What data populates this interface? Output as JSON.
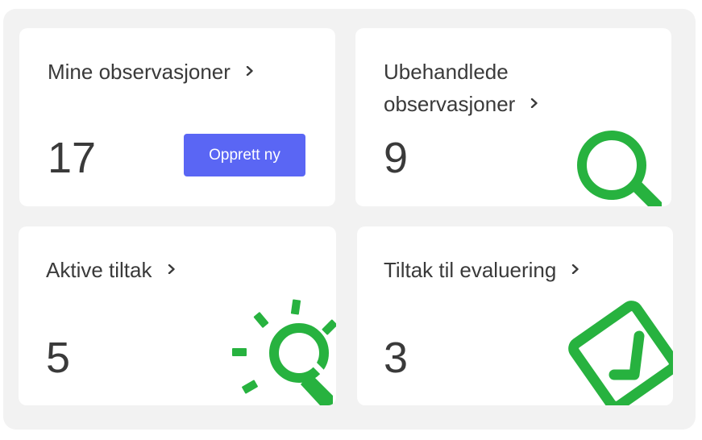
{
  "cards": [
    {
      "title": "Mine observasjoner",
      "count": "17",
      "button_label": "Opprett ny",
      "illustration_icon": "none"
    },
    {
      "title_line1": "Ubehandlede",
      "title_line2": "observasjoner",
      "count": "9",
      "illustration_icon": "magnifier-icon"
    },
    {
      "title": "Aktive tiltak",
      "count": "5",
      "illustration_icon": "lightbulb-icon"
    },
    {
      "title": "Tiltak til evaluering",
      "count": "3",
      "illustration_icon": "checkbox-icon"
    }
  ],
  "colors": {
    "accent": "#5a66f4",
    "illustration": "#27b23f",
    "text": "#3a3a3a",
    "panel_bg": "#f2f2f2",
    "card_bg": "#ffffff"
  }
}
